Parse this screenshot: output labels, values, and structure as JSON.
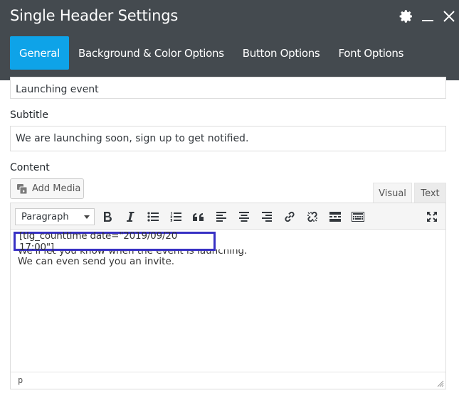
{
  "window": {
    "title": "Single Header Settings",
    "accent_color": "#0ea3e8",
    "header_bg": "#444a4f",
    "icons": [
      "gear-icon",
      "minimize-icon",
      "close-icon"
    ]
  },
  "tabs": [
    {
      "label": "General",
      "active": true
    },
    {
      "label": "Background & Color Options",
      "active": false
    },
    {
      "label": "Button Options",
      "active": false
    },
    {
      "label": "Font Options",
      "active": false
    }
  ],
  "form": {
    "title_value": "Launching event",
    "subtitle_label": "Subtitle",
    "subtitle_value": "We are launching soon, sign up to get notified.",
    "content_label": "Content"
  },
  "editor": {
    "add_media_label": "Add Media",
    "mode_visual": "Visual",
    "mode_text": "Text",
    "active_mode": "Visual",
    "format_select": "Paragraph",
    "toolbar_icons": [
      "bold-icon",
      "italic-icon",
      "bulleted-list-icon",
      "numbered-list-icon",
      "blockquote-icon",
      "align-left-icon",
      "align-center-icon",
      "align-right-icon",
      "link-icon",
      "unlink-icon",
      "read-more-icon",
      "toolbar-toggle-icon",
      "fullscreen-icon"
    ],
    "shortcode": "[tlg_counttime date=\"2019/09/20 17:00\"]",
    "line1": "We'll let you know when the event is launching.",
    "line2": "We can even send you an invite.",
    "status_path": "p",
    "highlight_color": "#3730c4"
  }
}
